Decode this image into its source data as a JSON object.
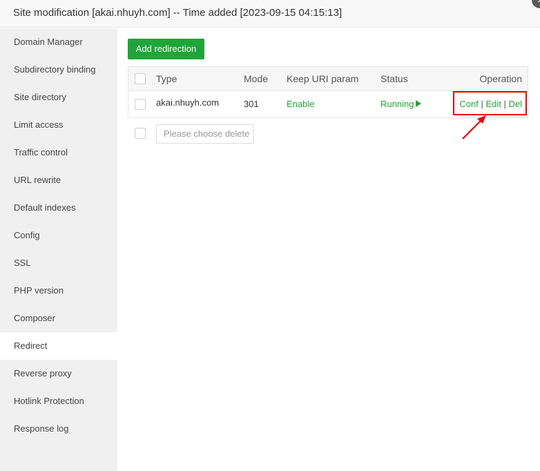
{
  "window": {
    "title": "Site modification [akai.nhuyh.com] -- Time added [2023-09-15 04:15:13]",
    "close_icon": "×"
  },
  "sidebar": {
    "items": [
      {
        "label": "Domain Manager",
        "active": false
      },
      {
        "label": "Subdirectory binding",
        "active": false
      },
      {
        "label": "Site directory",
        "active": false
      },
      {
        "label": "Limit access",
        "active": false
      },
      {
        "label": "Traffic control",
        "active": false
      },
      {
        "label": "URL rewrite",
        "active": false
      },
      {
        "label": "Default indexes",
        "active": false
      },
      {
        "label": "Config",
        "active": false
      },
      {
        "label": "SSL",
        "active": false
      },
      {
        "label": "PHP version",
        "active": false
      },
      {
        "label": "Composer",
        "active": false
      },
      {
        "label": "Redirect",
        "active": true
      },
      {
        "label": "Reverse proxy",
        "active": false
      },
      {
        "label": "Hotlink Protection",
        "active": false
      },
      {
        "label": "Response log",
        "active": false
      }
    ]
  },
  "main": {
    "add_button": "Add redirection",
    "table": {
      "headers": {
        "type": "Type",
        "mode": "Mode",
        "keep_uri": "Keep URI param",
        "status": "Status",
        "operation": "Operation"
      },
      "rows": [
        {
          "type": "akai.nhuyh.com",
          "mode": "301",
          "keep_uri": "Enable",
          "status": "Running",
          "ops": {
            "conf": "Conf",
            "sep1": " | ",
            "edit": "Edit",
            "sep2": " | ",
            "del": "Del"
          }
        }
      ]
    },
    "batch_placeholder": "Please choose delete"
  },
  "colors": {
    "accent": "#20a53a",
    "highlight": "#ee0000"
  }
}
